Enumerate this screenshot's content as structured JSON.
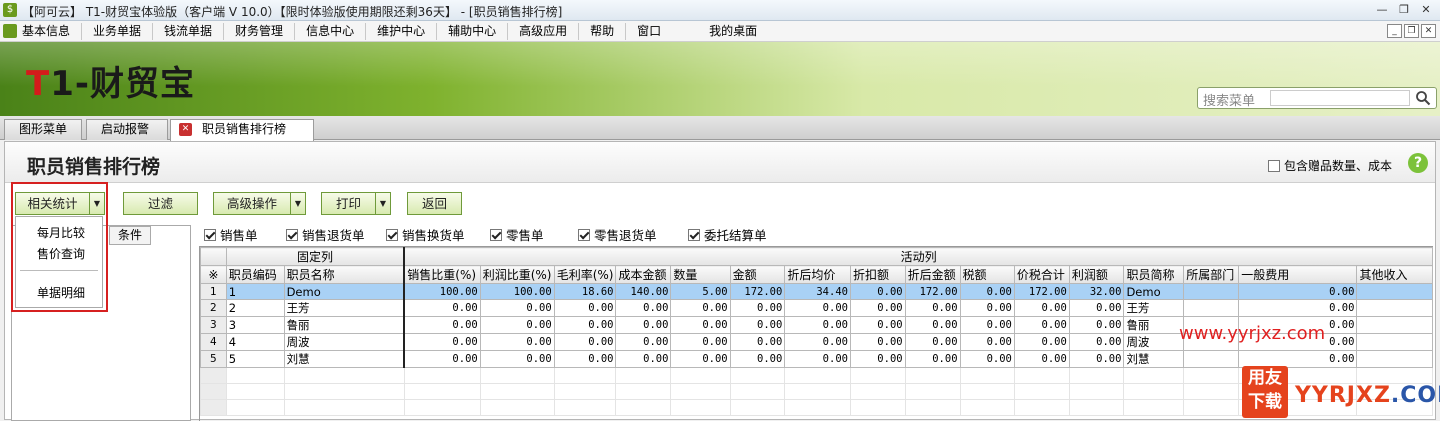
{
  "window": {
    "title": "【阿可云】 T1-财贸宝体验版（客户端 V 10.0）【限时体验版使用期限还剩36天】 - [职员销售排行榜]"
  },
  "menu": [
    "基本信息",
    "业务单据",
    "钱流单据",
    "财务管理",
    "信息中心",
    "维护中心",
    "辅助中心",
    "高级应用",
    "帮助",
    "窗口",
    "我的桌面"
  ],
  "brand": {
    "logo_t": "T",
    "logo_rest": "1-财贸宝"
  },
  "search": {
    "label": "搜索菜单"
  },
  "tabs": [
    "图形菜单",
    "启动报警",
    "职员销售排行榜"
  ],
  "page": {
    "title": "职员销售排行榜",
    "include_label": "包含赠品数量、成本",
    "help": "?"
  },
  "toolbar": {
    "related": "相关统计",
    "filter": "过滤",
    "advanced": "高级操作",
    "print": "打印",
    "back": "返回"
  },
  "related_menu": [
    "每月比较",
    "售价查询",
    "单据明细"
  ],
  "left_tab": "条件",
  "filters": [
    {
      "label": "销售单",
      "checked": true
    },
    {
      "label": "销售退货单",
      "checked": true
    },
    {
      "label": "销售换货单",
      "checked": true
    },
    {
      "label": "零售单",
      "checked": true
    },
    {
      "label": "零售退货单",
      "checked": true
    },
    {
      "label": "委托结算单",
      "checked": true
    }
  ],
  "grid": {
    "group_fixed": "固定列",
    "group_active": "活动列",
    "corner": "※",
    "columns": [
      "职员编码",
      "职员名称",
      "销售比重(%)",
      "利润比重(%)",
      "毛利率(%)",
      "成本金额",
      "数量",
      "金额",
      "折后均价",
      "折扣额",
      "折后金额",
      "税额",
      "价税合计",
      "利润额",
      "职员简称",
      "所属部门",
      "一般费用",
      "其他收入"
    ],
    "rows": [
      {
        "n": "1",
        "code": "1",
        "name": "Demo",
        "vals": [
          "100.00",
          "100.00",
          "18.60",
          "140.00",
          "5.00",
          "172.00",
          "34.40",
          "0.00",
          "172.00",
          "0.00",
          "172.00",
          "32.00"
        ],
        "short": "Demo",
        "dept": "",
        "fee": "0.00",
        "other": ""
      },
      {
        "n": "2",
        "code": "2",
        "name": "王芳",
        "vals": [
          "0.00",
          "0.00",
          "0.00",
          "0.00",
          "0.00",
          "0.00",
          "0.00",
          "0.00",
          "0.00",
          "0.00",
          "0.00",
          "0.00"
        ],
        "short": "王芳",
        "dept": "",
        "fee": "0.00",
        "other": ""
      },
      {
        "n": "3",
        "code": "3",
        "name": "鲁丽",
        "vals": [
          "0.00",
          "0.00",
          "0.00",
          "0.00",
          "0.00",
          "0.00",
          "0.00",
          "0.00",
          "0.00",
          "0.00",
          "0.00",
          "0.00"
        ],
        "short": "鲁丽",
        "dept": "",
        "fee": "0.00",
        "other": ""
      },
      {
        "n": "4",
        "code": "4",
        "name": "周波",
        "vals": [
          "0.00",
          "0.00",
          "0.00",
          "0.00",
          "0.00",
          "0.00",
          "0.00",
          "0.00",
          "0.00",
          "0.00",
          "0.00",
          "0.00"
        ],
        "short": "周波",
        "dept": "",
        "fee": "0.00",
        "other": ""
      },
      {
        "n": "5",
        "code": "5",
        "name": "刘慧",
        "vals": [
          "0.00",
          "0.00",
          "0.00",
          "0.00",
          "0.00",
          "0.00",
          "0.00",
          "0.00",
          "0.00",
          "0.00",
          "0.00",
          "0.00"
        ],
        "short": "刘慧",
        "dept": "",
        "fee": "0.00",
        "other": ""
      }
    ]
  },
  "watermark": {
    "url": "www.yyrjxz.com",
    "logo": "用友下载",
    "site_y": "YYRJXZ",
    "site_com": ".COM"
  }
}
